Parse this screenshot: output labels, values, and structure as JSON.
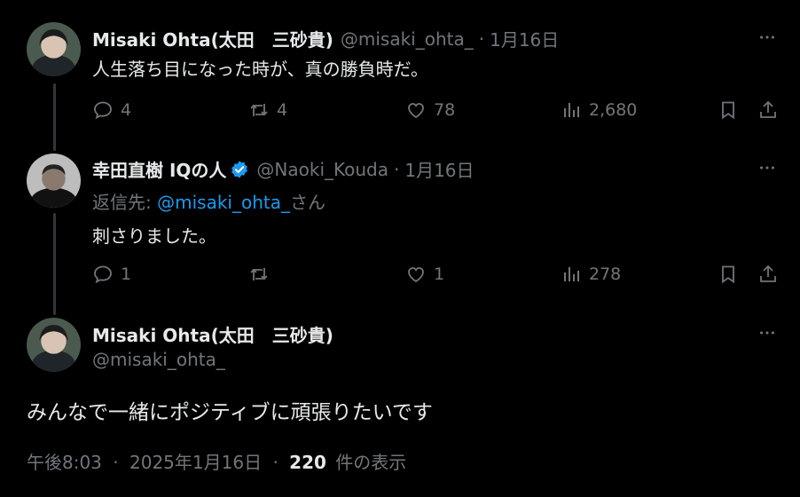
{
  "tweets": [
    {
      "author_name": "Misaki Ohta(太田　三砂貴)",
      "handle": "@misaki_ohta_",
      "separator": "·",
      "date": "1月16日",
      "text": "人生落ち目になった時が、真の勝負時だ。",
      "replies": "4",
      "reposts": "4",
      "likes": "78",
      "views": "2,680",
      "avatar_icon": "avatar-photo"
    },
    {
      "author_name": "幸田直樹 IQの人",
      "verified": true,
      "handle": "@Naoki_Kouda",
      "separator": "·",
      "date": "1月16日",
      "reply_to_prefix": "返信先: ",
      "reply_to_handle": "@misaki_ohta_",
      "reply_to_suffix": "さん",
      "text": "刺さりました。",
      "replies": "1",
      "reposts": "",
      "likes": "1",
      "views": "278",
      "avatar_icon": "avatar-photo"
    }
  ],
  "main_tweet": {
    "author_name": "Misaki Ohta(太田　三砂貴)",
    "handle": "@misaki_ohta_",
    "text": "みんなで一緒にポジティブに頑張りたいです",
    "time": "午後8:03",
    "separator": "·",
    "date": "2025年1月16日",
    "views_count": "220",
    "views_label": "件の表示"
  },
  "colors": {
    "background": "#000000",
    "text": "#e7e9ea",
    "muted": "#71767b",
    "link": "#1d9bf0",
    "thread_line": "#333639",
    "verified": "#1d9bf0"
  },
  "icons": [
    "more-icon",
    "reply-icon",
    "repost-icon",
    "like-icon",
    "views-icon",
    "bookmark-icon",
    "share-icon",
    "verified-badge-icon"
  ]
}
